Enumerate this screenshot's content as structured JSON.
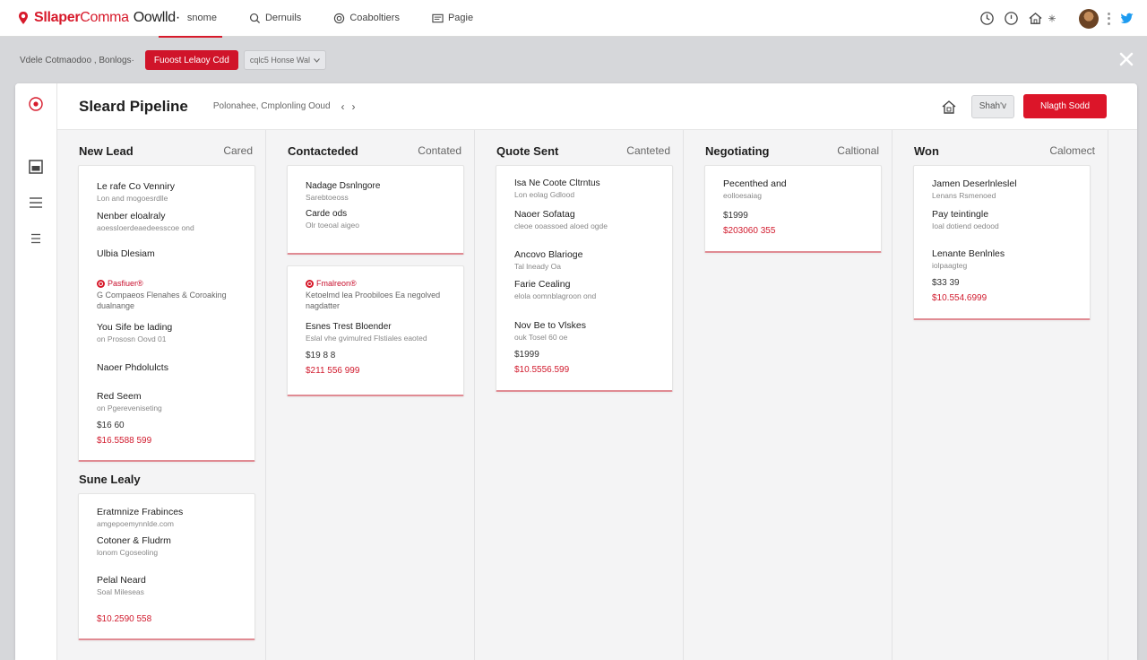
{
  "app": {
    "brand_bold": "Sllaper",
    "brand_light": "Comma",
    "brand_suffix": "Oowlld·"
  },
  "nav": [
    {
      "label": "snome",
      "icon": "home-icon"
    },
    {
      "label": "Dernuils",
      "icon": "search-icon"
    },
    {
      "label": "Coaboltiers",
      "icon": "globe-icon"
    },
    {
      "label": "Pagie",
      "icon": "page-icon"
    }
  ],
  "top_icons": [
    "clock-icon",
    "history-icon",
    "home-icon",
    "sparkle-icon",
    "avatar",
    "more-icon",
    "twitter-icon"
  ],
  "subbar": {
    "breadcrumb": "Vdele Cotmaodoo , Bonlogs·",
    "primary_button": "Fuoost Lelaoy Cdd",
    "secondary_button": "cqlc5 Honse Wal"
  },
  "header": {
    "title": "Sleard Pipeline",
    "subtitle": "Polonahee,  Cmplonling Ooud",
    "prev": "‹",
    "next": "›",
    "filter_button": "Shah'v",
    "new_button": "Nlagth Sodd"
  },
  "columns": [
    {
      "title": "New Lead",
      "count_label": "Cared",
      "card": {
        "entries": [
          {
            "name": "Le rafe Co Venniry",
            "sub": "Lon and mogoesrdlle"
          },
          {
            "name": "Nenber eloalraly",
            "sub": "aoessloerdeaedeesscoe ond"
          },
          {
            "name": "Ulbia Dlesiam",
            "sub": ""
          },
          {
            "flag": "Pasfiuer®",
            "name": "",
            "sub": "G Compaeos Flenahes & Coroaking",
            "sub2": "dualnange"
          },
          {
            "name": "You Sife be lading",
            "sub": "on Prososn Oovd  01"
          },
          {
            "name": "Naoer Phdolulcts",
            "sub": ""
          },
          {
            "name": "Red Seem",
            "sub": "on Pgereveniseting"
          }
        ],
        "amount": "$16 60",
        "total": "$16.5588 599"
      },
      "group": {
        "title": "Sune Lealy",
        "entries": [
          {
            "name": "Eratmnize Frabinces",
            "sub": "amgepoemynnlde.com"
          },
          {
            "name": "Cotoner & Fludrm",
            "sub": "lonom Cgoseoling"
          },
          {
            "name": "Pelal Neard",
            "sub": "Soal Mileseas"
          }
        ],
        "total": "$10.2590 558"
      }
    },
    {
      "title": "Contacteded",
      "count_label": "Contated",
      "cards": [
        {
          "entries": [
            {
              "name": "Nadage Dsnlngore",
              "sub": "Sarebtoeoss"
            },
            {
              "name": "Carde ods",
              "sub": "Olr toeoal aigeo"
            }
          ]
        },
        {
          "entries": [
            {
              "flag": "Fmalreon®",
              "name": "",
              "sub": "Ketoelmd lea Proobiloes  Ea negolved",
              "sub2": "nagdatter"
            },
            {
              "name": "Esnes Trest Bloender",
              "sub": "Eslal vhe gvimulred Flstiales eaoted"
            }
          ],
          "amount": "$19 8 8",
          "total": "$211 556 999"
        }
      ]
    },
    {
      "title": "Quote Sent",
      "count_label": "Canteted",
      "card": {
        "entries": [
          {
            "name": "Isa Ne Coote Cltrntus",
            "sub": "Lon eolag Gdlood"
          },
          {
            "name": "Naoer Sofatag",
            "sub": "cleoe ooassoed aloed ogde"
          },
          {
            "name": "Ancovo Blarioge",
            "sub": "Tal lneady Oa"
          },
          {
            "name": "Farie Cealing",
            "sub": "elola oomnblagroon ond"
          },
          {
            "name": "Nov Be to Vlskes",
            "sub": "ouk Tosel  60 oe"
          }
        ],
        "amount": "$1999",
        "total": "$10.5556.599"
      }
    },
    {
      "title": "Negotiating",
      "count_label": "Caltional",
      "card": {
        "entries": [
          {
            "name": "Pecenthed and",
            "sub": "eolloesaiag"
          }
        ],
        "amount": "$1999",
        "total": "$203060 355"
      }
    },
    {
      "title": "Won",
      "count_label": "Calomect",
      "card": {
        "entries": [
          {
            "name": "Jamen Deserlnleslel",
            "sub": "Lenans Rsmenoed"
          },
          {
            "name": "Pay teintingle",
            "sub": "Ioal dotiend oedood"
          },
          {
            "name": "Lenante Benlnles",
            "sub": "iolpaagteg"
          }
        ],
        "amount": "$33 39",
        "total": "$10.554.6999"
      }
    }
  ],
  "colors": {
    "accent": "#d71a2b",
    "card_border": "#e08b93",
    "board_bg": "#f4f4f5",
    "chrome_bg": "#d6d7da"
  }
}
